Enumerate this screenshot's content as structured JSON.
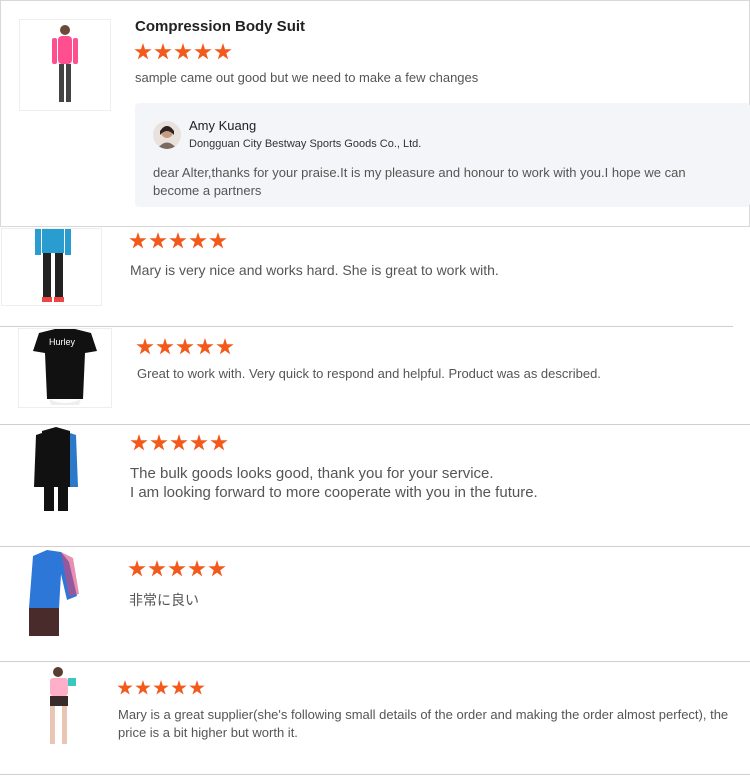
{
  "reviews": [
    {
      "product_title": "Compression Body Suit",
      "rating": 5,
      "comment": "sample came out good  but we need to make a few changes",
      "reply": {
        "author": "Amy Kuang",
        "company": "Dongguan City Bestway Sports Goods Co., Ltd.",
        "text": "dear Alter,thanks for your praise.It is my pleasure and honour to work with you.I hope we can become a partners"
      },
      "image_icon": "pink-long-sleeve-suit-icon"
    },
    {
      "rating": 5,
      "comment": "Mary is very nice and works hard. She is great to work with.",
      "image_icon": "blue-rash-guard-icon"
    },
    {
      "rating": 5,
      "comment": "Great to work with.  Very quick to respond and helpful.  Product was as described.",
      "image_icon": "black-short-sleeve-shirt-icon",
      "shirt_logo": "Hurley"
    },
    {
      "rating": 5,
      "comment_line1": "The bulk goods looks good, thank you for your service.",
      "comment_line2": "I am looking forward to more cooperate with you in the future.",
      "image_icon": "black-long-sleeve-rash-guard-icon"
    },
    {
      "rating": 5,
      "comment": "非常に良い",
      "image_icon": "blue-floral-rash-guard-icon"
    },
    {
      "rating": 5,
      "comment": "Mary is a great supplier(she's following small details of the order and making the order almost perfect), the price is a bit higher but worth it.",
      "image_icon": "pink-yoga-set-icon"
    }
  ],
  "colors": {
    "star": "#f2591b",
    "reply_bg": "#f4f5f8",
    "divider": "#cfcfcf"
  }
}
